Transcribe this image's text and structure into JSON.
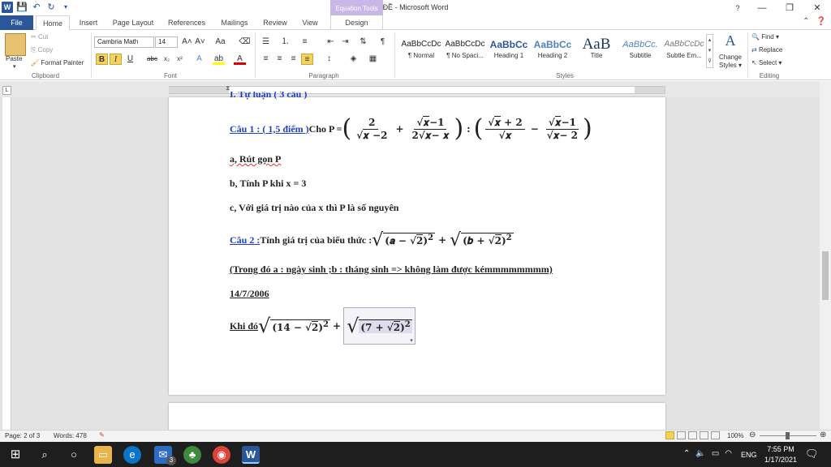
{
  "window": {
    "title": "ĐỀ  -  Microsoft Word",
    "contextual_tab_group": "Equation Tools",
    "controls": {
      "minimize": "—",
      "restore": "❐",
      "close": "✕"
    }
  },
  "tabs": {
    "file": "File",
    "items": [
      "Home",
      "Insert",
      "Page Layout",
      "References",
      "Mailings",
      "Review",
      "View"
    ],
    "design": "Design"
  },
  "ribbon": {
    "clipboard": {
      "paste": "Paste",
      "cut": "Cut",
      "copy": "Copy",
      "format_painter": "Format Painter",
      "label": "Clipboard"
    },
    "font": {
      "name": "Cambria Math",
      "size": "14",
      "label": "Font",
      "bold": "B",
      "italic": "I",
      "underline": "U"
    },
    "paragraph": {
      "label": "Paragraph"
    },
    "styles": {
      "label": "Styles",
      "tiles": [
        {
          "sample": "AaBbCcDc",
          "name": "¶ Normal"
        },
        {
          "sample": "AaBbCcDc",
          "name": "¶ No Spaci..."
        },
        {
          "sample": "AaBbCc",
          "name": "Heading 1"
        },
        {
          "sample": "AaBbCc",
          "name": "Heading 2"
        },
        {
          "sample": "AaB",
          "name": "Title"
        },
        {
          "sample": "AaBbCc.",
          "name": "Subtitle"
        },
        {
          "sample": "AaBbCcDc",
          "name": "Subtle Em..."
        }
      ],
      "change_styles": "Change Styles ▾"
    },
    "editing": {
      "find": "Find ▾",
      "replace": "Replace",
      "select": "Select ▾",
      "label": "Editing"
    }
  },
  "document": {
    "cut_line": "I. Tự luận ( 3 câu )",
    "q1_label": "Câu 1 : ( 1,5 điểm )",
    "q1_text": " Cho P = ",
    "q1a": "a, Rút gọn P",
    "q1b": "b, Tính P khi x = 3",
    "q1c": "c, Với giá trị nào của x thì P là số nguyên",
    "q2_label": "Câu 2 :",
    "q2_text": " Tính giá trị của biểu thức : ",
    "note": "(Trong đó a : ngày sinh ;b : tháng sinh => không làm được kémmmmmmmm)",
    "date": "14/7/2006",
    "khi_do": "Khi đó",
    "eq_a": "14",
    "eq_b": "7"
  },
  "status": {
    "page": "Page: 2 of 3",
    "words": "Words: 478",
    "zoom": "100%"
  },
  "taskbar": {
    "lang": "ENG",
    "time": "7:55 PM",
    "date": "1/17/2021",
    "mail_badge": "3"
  },
  "colors": {
    "accent": "#2b579a",
    "equation_tools": "#c9b7e7",
    "question_blue": "#2040c0"
  }
}
